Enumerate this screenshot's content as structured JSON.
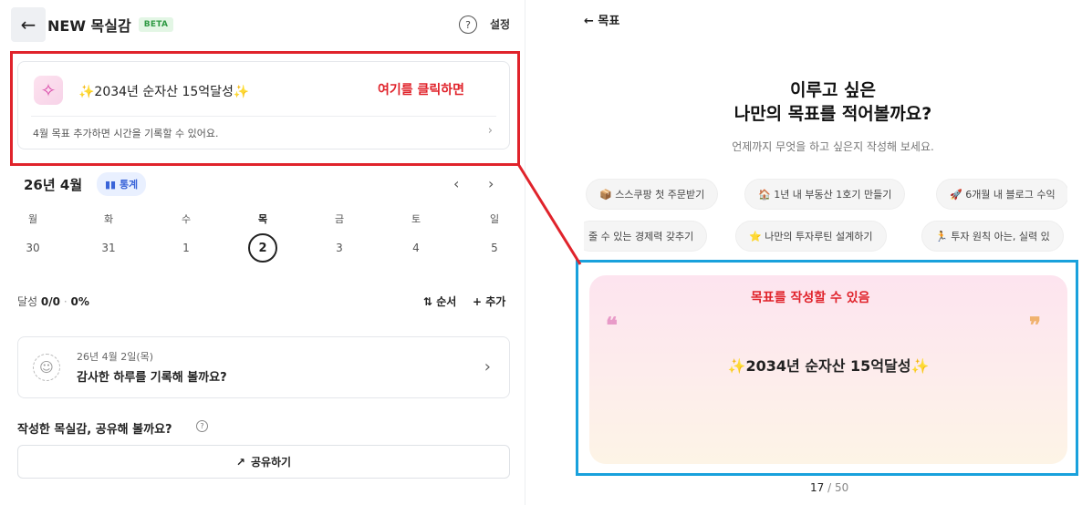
{
  "left": {
    "header": {
      "back_icon": "←",
      "title": "NEW 목실감",
      "badge": "BETA",
      "help_icon": "?",
      "settings": "설정"
    },
    "goal_card": {
      "icon": "✧",
      "title": "✨2034년 순자산 15억달성✨",
      "subtitle": "4월 목표  추가하면 시간을 기록할 수 있어요.",
      "chevron": "›",
      "annotation": "여기를 클릭하면"
    },
    "calendar": {
      "month": "26년 4월",
      "stats_label": "통계",
      "prev": "‹",
      "next": "›",
      "weekdays": [
        "월",
        "화",
        "수",
        "목",
        "금",
        "토",
        "일"
      ],
      "days": [
        "30",
        "31",
        "1",
        "2",
        "3",
        "4",
        "5"
      ],
      "today_index": 3
    },
    "achievement": {
      "label": "달성",
      "count": "0/0",
      "sep": "·",
      "percent": "0%",
      "order": "⇅ 순서",
      "add": "+ 추가"
    },
    "diary": {
      "date": "26년 4월 2일(목)",
      "prompt": "감사한 하루를 기록해 볼까요?",
      "chevron": "›",
      "icon": "☺"
    },
    "share": {
      "question": "작성한 목실감, 공유해 볼까요?",
      "help": "?",
      "button": "공유하기",
      "button_icon": "↗"
    }
  },
  "right": {
    "back": "← 목표",
    "hero_line1": "이루고 싶은",
    "hero_line2": "나만의 목표를 적어볼까요?",
    "hero_sub": "언제까지 무엇을 하고 싶은지 작성해 보세요.",
    "chips_row1": [
      "📦 스스쿠팡 첫 주문받기",
      "🏠 1년 내 부동산 1호기 만들기",
      "🚀 6개월 내 블로그 수익"
    ],
    "chips_row2": [
      "줄 수 있는 경제력 갖추기",
      "⭐ 나만의 투자루틴 설계하기",
      "🏃 투자 원칙 아는, 실력 있"
    ],
    "panel_annotation": "목표를 작성할 수 있음",
    "quote_open": "❝",
    "quote_close": "❞",
    "goal_text": "✨2034년 순자산 15억달성✨",
    "counter_current": "17",
    "counter_total": "/ 50"
  },
  "colors": {
    "annotation_red": "#e0232b",
    "annotation_blue": "#19a1dc",
    "badge_green": "#2f9a44",
    "stats_blue": "#3a64d8"
  }
}
